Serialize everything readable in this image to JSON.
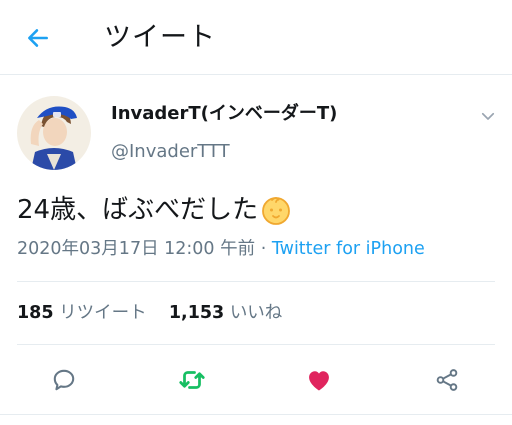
{
  "header": {
    "title": "ツイート",
    "back_icon": "arrow-left-icon"
  },
  "tweet": {
    "display_name": "InvaderT(インベーダーT)",
    "handle": "@InvaderTTT",
    "text": "24歳、ばぶべだした",
    "emoji": "baby-face-emoji",
    "date": "2020年03月17日 12:00 午前",
    "separator": " · ",
    "source": "Twitter for iPhone"
  },
  "stats": {
    "retweets_count": "185",
    "retweets_label": "リツイート",
    "likes_count": "1,153",
    "likes_label": "いいね"
  },
  "actions": [
    "reply-icon",
    "retweet-icon",
    "like-icon",
    "share-icon"
  ],
  "colors": {
    "accent": "#1da1f2",
    "retweet": "#17bf63",
    "like": "#e0245e",
    "muted": "#657786"
  }
}
